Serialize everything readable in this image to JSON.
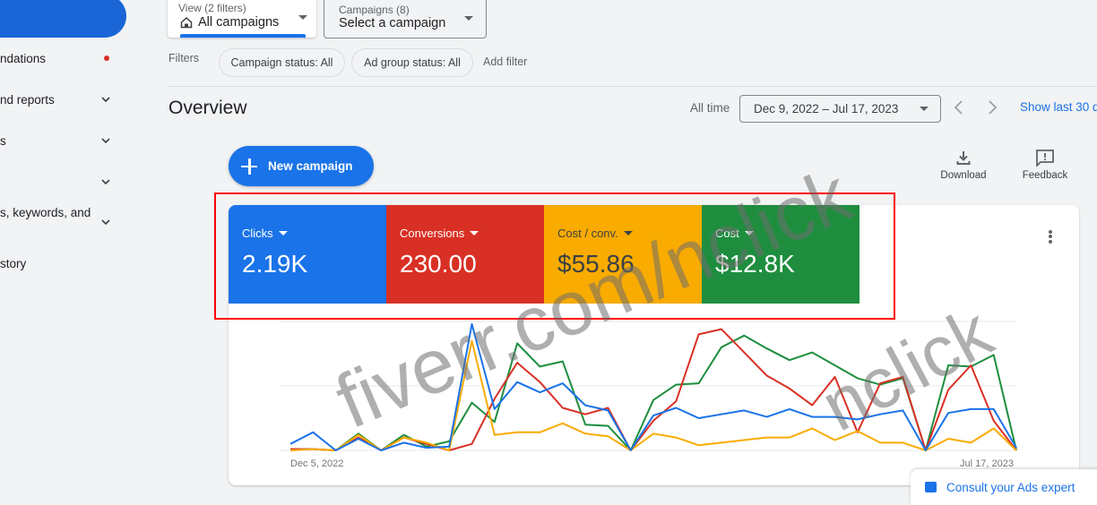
{
  "sidebar": {
    "items": [
      {
        "label": "ndations",
        "indicator": "red-dot"
      },
      {
        "label": "nd reports",
        "indicator": "chevron-down"
      },
      {
        "label": "s",
        "indicator": "chevron-down"
      },
      {
        "label": "",
        "indicator": "chevron-down"
      },
      {
        "label": "s, keywords, and",
        "indicator": "chevron-down"
      },
      {
        "label": "story",
        "indicator": ""
      }
    ]
  },
  "header": {
    "view_selector": {
      "caption": "View (2 filters)",
      "value": "All campaigns",
      "icon": "home-icon"
    },
    "campaign_selector": {
      "caption": "Campaigns (8)",
      "value": "Select a campaign"
    },
    "filters": {
      "label": "Filters",
      "chips": [
        "Campaign status: All",
        "Ad group status: All"
      ],
      "add_label": "Add filter"
    }
  },
  "overview": {
    "title": "Overview",
    "range_label": "All time",
    "date_range": "Dec 9, 2022 – Jul 17, 2023",
    "show_last": "Show last 30 d",
    "new_campaign_label": "New campaign",
    "download_label": "Download",
    "feedback_label": "Feedback"
  },
  "metrics": [
    {
      "label": "Clicks",
      "value": "2.19K",
      "color": "#1a73e8",
      "text_color": "#ffffff"
    },
    {
      "label": "Conversions",
      "value": "230.00",
      "color": "#d93025",
      "text_color": "#ffffff"
    },
    {
      "label": "Cost / conv.",
      "value": "$55.86",
      "color": "#f9ab00",
      "text_color": "#3c4043"
    },
    {
      "label": "Cost",
      "value": "$12.8K",
      "color": "#1e8e3e",
      "text_color": "#ffffff"
    }
  ],
  "chart_data": {
    "type": "line",
    "x_start_label": "Dec 5, 2022",
    "x_end_label": "Jul 17, 2023",
    "ylim": [
      0,
      100
    ],
    "y_scale": "normalized per-metric (relative)",
    "grid": true,
    "series": [
      {
        "name": "Clicks",
        "color": "#1a73e8",
        "values": [
          5,
          14,
          0,
          9,
          0,
          6,
          2,
          3,
          98,
          32,
          53,
          45,
          52,
          35,
          31,
          0,
          27,
          33,
          25,
          28,
          31,
          26,
          32,
          26,
          26,
          24,
          28,
          31,
          0,
          29,
          32,
          32,
          2
        ]
      },
      {
        "name": "Conversions",
        "color": "#d93025",
        "values": [
          1,
          1,
          0,
          10,
          0,
          10,
          5,
          0,
          5,
          40,
          68,
          53,
          33,
          28,
          33,
          0,
          23,
          38,
          90,
          94,
          76,
          58,
          48,
          35,
          57,
          14,
          52,
          57,
          0,
          47,
          66,
          23,
          0
        ]
      },
      {
        "name": "Cost / conv.",
        "color": "#f9ab00",
        "values": [
          0,
          1,
          0,
          12,
          0,
          10,
          6,
          0,
          85,
          12,
          14,
          14,
          21,
          13,
          11,
          0,
          13,
          10,
          4,
          6,
          8,
          10,
          10,
          17,
          8,
          15,
          6,
          6,
          0,
          9,
          6,
          17,
          0
        ]
      },
      {
        "name": "Cost",
        "color": "#1e8e3e",
        "values": [
          1,
          1,
          0,
          13,
          0,
          12,
          3,
          7,
          37,
          22,
          83,
          65,
          69,
          20,
          19,
          0,
          39,
          51,
          52,
          80,
          89,
          79,
          70,
          76,
          66,
          56,
          51,
          56,
          0,
          66,
          65,
          74,
          0
        ]
      }
    ]
  },
  "consult": {
    "label": "Consult your Ads expert"
  },
  "watermarks": [
    "fiverr.com/nclick",
    "nclick"
  ]
}
